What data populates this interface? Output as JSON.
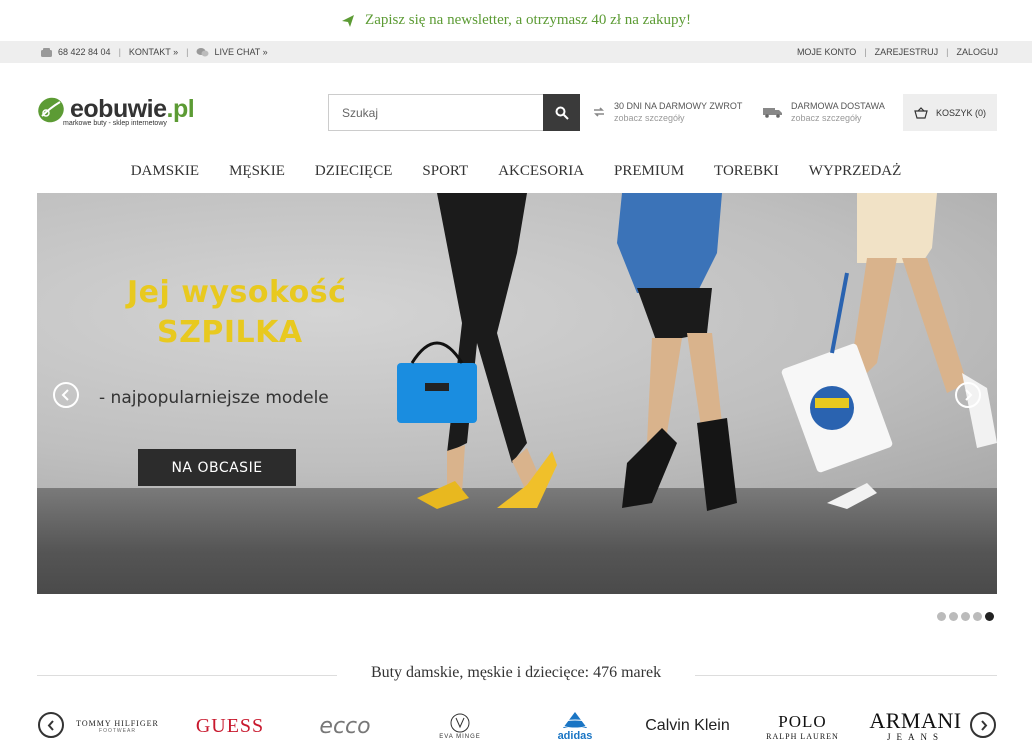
{
  "promo": {
    "text": "Zapisz się na newsletter, a otrzymasz 40 zł na zakupy!"
  },
  "topbar": {
    "phone": "68 422 84 04",
    "contact": "KONTAKT »",
    "livechat": "LIVE CHAT »",
    "account": "MOJE KONTO",
    "register": "ZAREJESTRUJ",
    "login": "ZALOGUJ"
  },
  "header": {
    "logo_main": "eobuwie",
    "logo_tld": ".pl",
    "logo_tagline": "markowe buty - sklep internetowy",
    "search_placeholder": "Szukaj",
    "perk_return_title": "30 DNI NA DARMOWY ZWROT",
    "perk_return_link": "zobacz szczegóły",
    "perk_delivery_title": "DARMOWA DOSTAWA",
    "perk_delivery_link": "zobacz szczegóły",
    "cart_label": "KOSZYK (0)"
  },
  "nav": {
    "items": [
      "DAMSKIE",
      "MĘSKIE",
      "DZIECIĘCE",
      "SPORT",
      "AKCESORIA",
      "PREMIUM",
      "TOREBKI",
      "WYPRZEDAŻ"
    ]
  },
  "hero": {
    "title_line1": "Jej wysokość",
    "title_line2": "SZPILKA",
    "subtitle": "- najpopularniejsze modele",
    "cta": "NA OBCASIE",
    "slides_total": 5,
    "active_slide": 5
  },
  "brands": {
    "title": "Buty damskie, męskie i dziecięce: 476 marek",
    "items": {
      "tommy": "TOMMY HILFIGER",
      "tommy_sub": "FOOTWEAR",
      "guess": "GUESS",
      "ecco": "ecco",
      "eva": "EVA MINGE",
      "adidas": "adidas",
      "ck": "Calvin Klein",
      "polo": "POLO",
      "polo_sub": "RALPH LAUREN",
      "armani": "ARMANI",
      "armani_sub": "JEANS"
    }
  },
  "colors": {
    "brand_green": "#5c9b34",
    "hero_yellow": "#e8c91f",
    "dark": "#3a3a3a"
  }
}
